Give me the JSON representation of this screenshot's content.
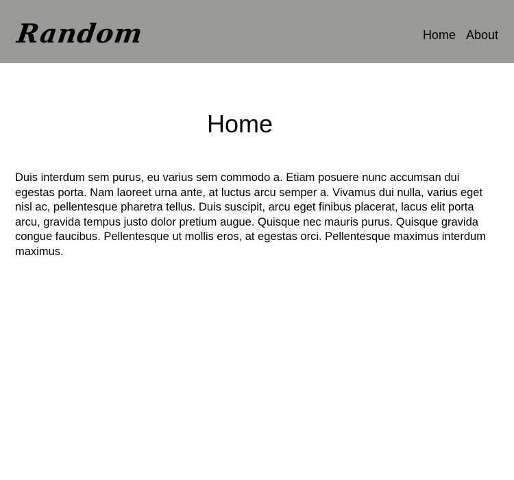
{
  "header": {
    "logo_text": "Random",
    "background_color": "#999998",
    "nav": [
      {
        "label": "Home"
      },
      {
        "label": "About"
      }
    ]
  },
  "main": {
    "title": "Home",
    "paragraph": "Duis interdum sem purus, eu varius sem commodo a. Etiam posuere nunc accumsan dui egestas porta. Nam laoreet urna ante, at luctus arcu semper a. Vivamus dui nulla, varius eget nisl ac, pellentesque pharetra tellus. Duis suscipit, arcu eget finibus placerat, lacus elit porta arcu, gravida tempus justo dolor pretium augue. Quisque nec mauris purus. Quisque gravida congue faucibus. Pellentesque ut mollis eros, at egestas orci. Pellentesque maximus interdum maximus."
  }
}
